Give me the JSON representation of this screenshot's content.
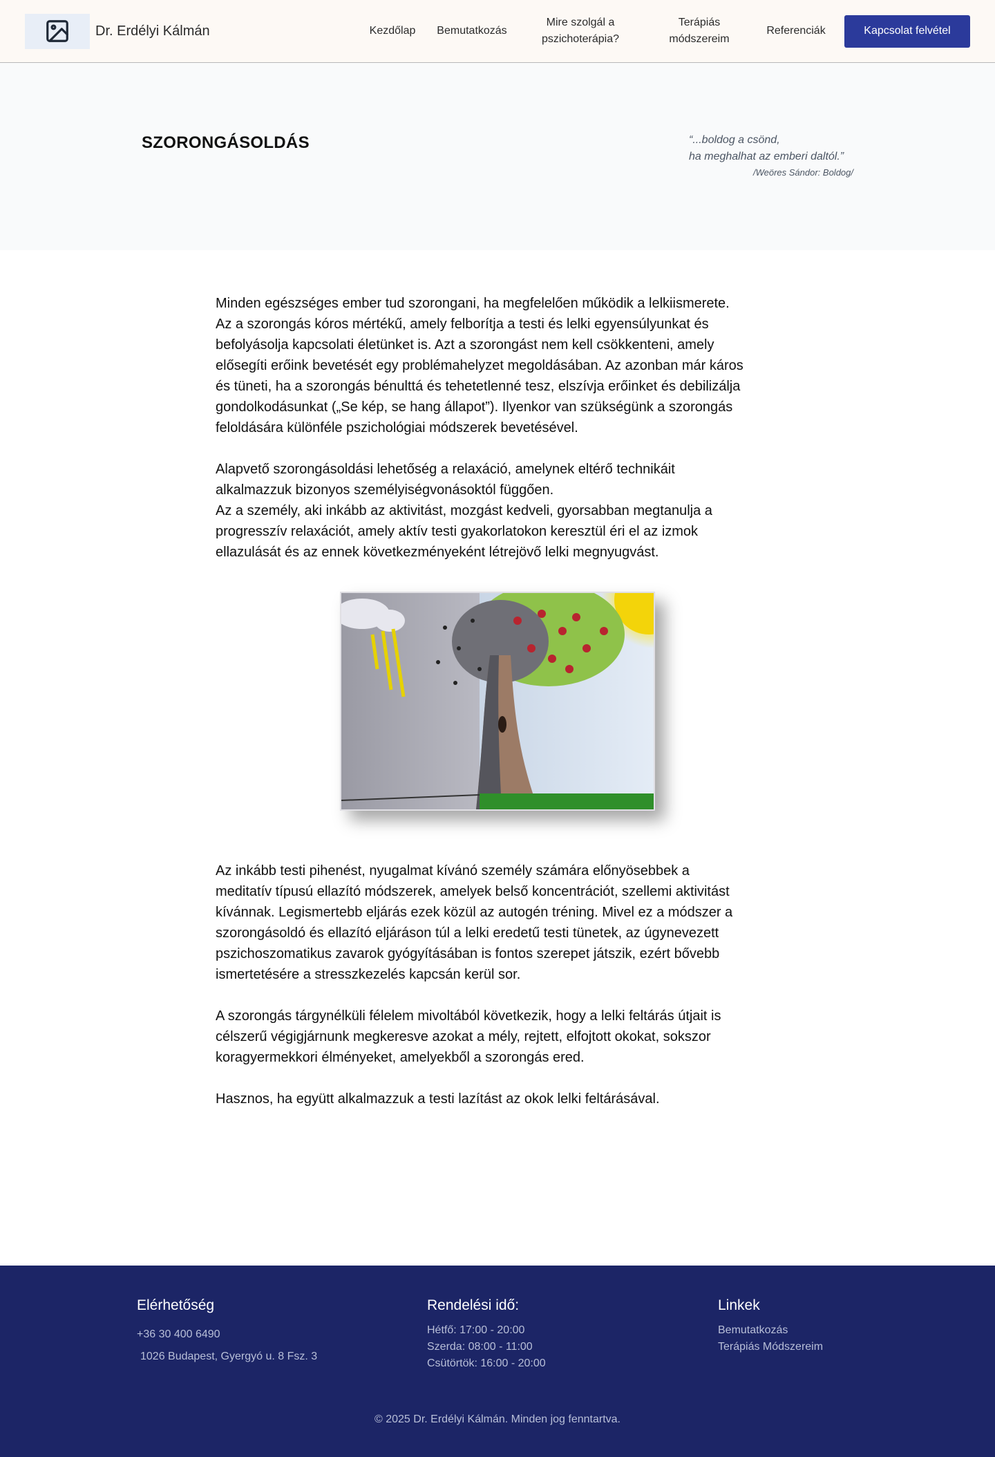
{
  "header": {
    "brand": "Dr. Erdélyi Kálmán",
    "logo_icon": "image-placeholder-icon",
    "nav": [
      {
        "label": "Kezdőlap"
      },
      {
        "label": "Bemutatkozás"
      },
      {
        "label": "Mire szolgál a pszichoterápia?"
      },
      {
        "label": "Terápiás módszereim"
      },
      {
        "label": "Referenciák"
      }
    ],
    "cta_label": "Kapcsolat felvétel"
  },
  "hero": {
    "title": "SZORONGÁSOLDÁS",
    "quote_line1": "“...boldog a csönd,",
    "quote_line2": "ha meghalhat az emberi daltól.”",
    "quote_source": "/Weöres Sándor: Boldog/"
  },
  "content": {
    "para1_lines": [
      "Minden egészséges ember tud szorongani, ha megfelelően működik a lelkiismerete.",
      "Az a szorongás kóros mértékű, amely felborítja a testi és lelki egyensúlyunkat és",
      "befolyásolja kapcsolati életünket is. Azt a szorongást nem kell csökkenteni, amely",
      "elősegíti erőink bevetését egy problémahelyzet megoldásában. Az azonban már káros",
      "és tüneti, ha a szorongás bénulttá és tehetetlenné tesz, elszívja erőinket és debilizálja",
      "gondolkodásunkat („Se kép, se hang állapot”). Ilyenkor van szükségünk a szorongás",
      "feloldására különféle pszichológiai módszerek bevetésével."
    ],
    "para2_lines": [
      "Alapvető szorongásoldási lehetőség a relaxáció, amelynek eltérő technikáit",
      "alkalmazzuk bizonyos személyiségvonásoktól függően.",
      "Az a személy, aki inkább az aktivitást, mozgást kedveli, gyorsabban megtanulja a",
      "progresszív relaxációt, amely aktív testi gyakorlatokon keresztül éri el az izmok",
      "ellazulását és az ennek következményeként létrejövő lelki megnyugvást."
    ],
    "para3_lines": [
      "Az inkább testi pihenést, nyugalmat kívánó személy számára előnyösebbek a",
      "meditatív típusú ellazító módszerek, amelyek belső koncentrációt, szellemi aktivitást",
      "kívánnak. Legismertebb eljárás ezek közül az autogén tréning. Mivel ez a módszer a",
      "szorongásoldó és ellazító eljáráson túl a lelki eredetű testi tünetek, az úgynevezett",
      "pszichoszomatikus zavarok gyógyításában is fontos szerepet játszik, ezért bővebb",
      "ismertetésére a stresszkezelés kapcsán kerül sor."
    ],
    "para4_lines": [
      "A szorongás tárgynélküli félelem mivoltából következik, hogy a lelki feltárás útjait is",
      "célszerű végigjárnunk megkeresve azokat a mély, rejtett, elfojtott okokat, sokszor",
      "koragyermekkori élményeket, amelyekből a szorongás ered."
    ],
    "para5": "Hasznos, ha együtt alkalmazzuk a testi lazítást az okok lelki feltárásával."
  },
  "footer": {
    "col1_heading": "Elérhetőség",
    "phone": "+36 30 400 6490",
    "address": "1026 Budapest, Gyergyó u. 8 Fsz. 3",
    "col2_heading": "Rendelési idő:",
    "hours": [
      "Hétfő: 17:00 - 20:00",
      "Szerda: 08:00 - 11:00",
      "Csütörtök: 16:00 - 20:00"
    ],
    "col3_heading": "Linkek",
    "links": [
      {
        "label": "Bemutatkozás"
      },
      {
        "label": "Terápiás Módszereim"
      }
    ],
    "copyright": "© 2025 Dr. Erdélyi Kálmán. Minden jog fenntartva."
  },
  "colors": {
    "header_bg": "#fdf9f5",
    "cta_bg": "#2b3a9b",
    "footer_bg": "#1c2566",
    "hero_bg": "#f9fafb"
  }
}
